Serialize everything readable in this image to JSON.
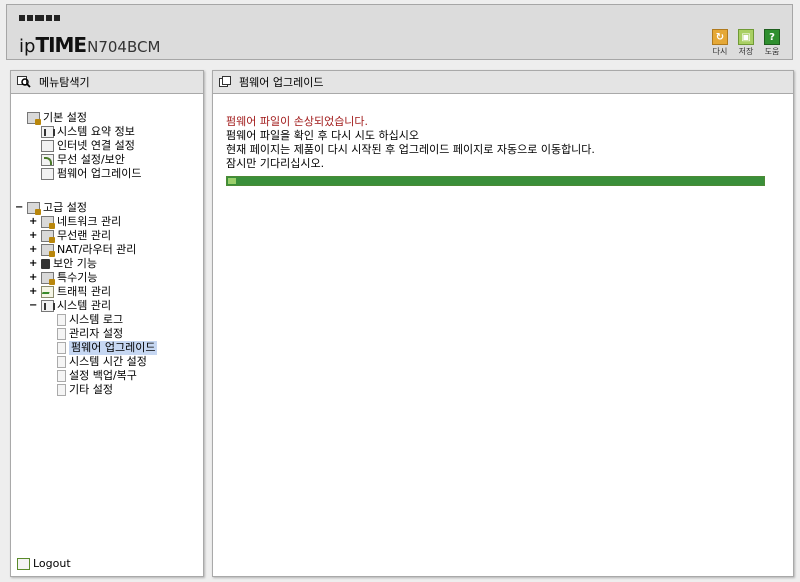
{
  "header": {
    "brand_prefix": "ip",
    "brand_main": "TIME",
    "model": "N704BCM",
    "tools": [
      {
        "label": "다시",
        "icon": "reload-icon",
        "color": "#e5a837"
      },
      {
        "label": "저장",
        "icon": "save-icon",
        "color": "#a9cf63"
      },
      {
        "label": "도움",
        "icon": "help-icon",
        "color": "#2f8f2f"
      }
    ]
  },
  "left_panel": {
    "title": "메뉴탐색기",
    "basic": {
      "label": "기본 설정",
      "items": [
        "시스템 요약 정보",
        "인터넷 연결 설정",
        "무선 설정/보안",
        "펌웨어 업그레이드"
      ]
    },
    "advanced": {
      "expander": "−",
      "label": "고급 설정",
      "groups": [
        {
          "expander": "+",
          "label": "네트워크 관리"
        },
        {
          "expander": "+",
          "label": "무선랜 관리"
        },
        {
          "expander": "+",
          "label": "NAT/라우터 관리"
        },
        {
          "expander": "+",
          "label": "보안 기능"
        },
        {
          "expander": "+",
          "label": "특수기능"
        },
        {
          "expander": "+",
          "label": "트래픽 관리"
        },
        {
          "expander": "−",
          "label": "시스템 관리"
        }
      ],
      "system_items": [
        "시스템 로그",
        "관리자 설정",
        "펌웨어 업그레이드",
        "시스템 시간 설정",
        "설정 백업/복구",
        "기타 설정"
      ],
      "selected_index": 2
    },
    "logout_label": "Logout"
  },
  "main": {
    "title": "펌웨어 업그레이드",
    "error": "펌웨어 파일이 손상되었습니다.",
    "lines": [
      "펌웨어 파일을 확인 후 다시 시도 하십시오",
      "현재 페이지는 제품이 다시 시작된 후 업그레이드 페이지로 자동으로 이동합니다.",
      "잠시만 기다리십시오."
    ],
    "progress_fraction": 1.0,
    "progress_color": "#3a8f3a"
  }
}
